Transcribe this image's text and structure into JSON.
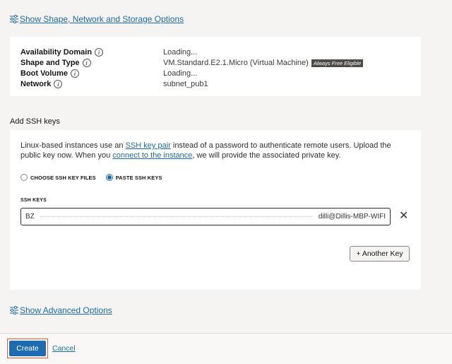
{
  "links": {
    "shape_options": "Show Shape, Network and Storage Options",
    "advanced_options": "Show Advanced Options"
  },
  "summary": [
    {
      "label": "Availability Domain",
      "value": "Loading..."
    },
    {
      "label": "Shape and Type",
      "value": "VM.Standard.E2.1.Micro (Virtual Machine)",
      "badge": "Always Free Eligible"
    },
    {
      "label": "Boot Volume",
      "value": "Loading..."
    },
    {
      "label": "Network",
      "value": "subnet_pub1"
    }
  ],
  "ssh": {
    "section_title": "Add SSH keys",
    "desc_part1": "Linux-based instances use an ",
    "desc_link1": "SSH key pair",
    "desc_part2": " instead of a password to authenticate remote users. Upload the public key now. When you ",
    "desc_link2": "connect to the instance",
    "desc_part3": ", we will provide the associated private key.",
    "radio_files": "CHOOSE SSH KEY FILES",
    "radio_paste": "PASTE SSH KEYS",
    "selected": "paste",
    "keys_label": "SSH KEYS",
    "key_value_start": "BZ",
    "key_value_end": "dilli@Dillis-MBP-WIFI",
    "another_key": "+ Another Key"
  },
  "footer": {
    "create": "Create",
    "cancel": "Cancel"
  },
  "colors": {
    "link": "#1a6aab",
    "primary_button": "#1d6cb0",
    "highlight_border": "#e65a39"
  }
}
